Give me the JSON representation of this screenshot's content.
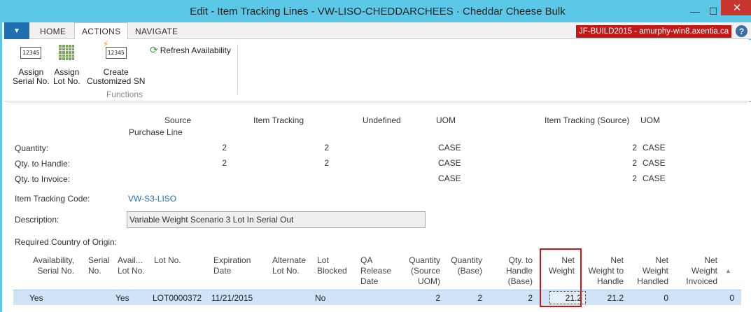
{
  "window": {
    "title": "Edit - Item Tracking Lines - VW-LISO-CHEDDARCHEES · Cheddar Cheese Bulk",
    "minimize_glyph": "—",
    "maximize_glyph": "☐",
    "close_glyph": "✕"
  },
  "ribbon": {
    "tabs": [
      "HOME",
      "ACTIONS",
      "NAVIGATE"
    ],
    "active_tab": "ACTIONS",
    "server_badge": "JF-BUILD2015 - amurphy-win8.axentia.ca",
    "help_glyph": "?",
    "buttons": {
      "assign_serial": {
        "line1": "Assign",
        "line2": "Serial No.",
        "icon": "serial-number-icon"
      },
      "assign_lot": {
        "line1": "Assign",
        "line2": "Lot No.",
        "icon": "lot-grid-icon"
      },
      "create_custom_sn": {
        "line1": "Create",
        "line2": "Customized SN",
        "icon": "custom-serial-icon"
      }
    },
    "refresh_label": "Refresh Availability",
    "group_label": "Functions",
    "serial_icon_text": "12345"
  },
  "summary": {
    "headers": {
      "source": "Source",
      "source_sub": "Purchase Line",
      "item_tracking": "Item Tracking",
      "undefined": "Undefined",
      "uom": "UOM",
      "item_tracking_source": "Item Tracking (Source)",
      "uom2": "UOM"
    },
    "rows": [
      {
        "label": "Quantity:",
        "source": "2",
        "item_tracking": "2",
        "uom": "CASE",
        "its": "2",
        "uom2": "CASE"
      },
      {
        "label": "Qty. to Handle:",
        "source": "2",
        "item_tracking": "2",
        "uom": "CASE",
        "its": "2",
        "uom2": "CASE"
      },
      {
        "label": "Qty. to Invoice:",
        "source": "",
        "item_tracking": "",
        "uom": "CASE",
        "its": "2",
        "uom2": "CASE"
      }
    ]
  },
  "fields": {
    "item_tracking_code_label": "Item Tracking Code:",
    "item_tracking_code_value": "VW-S3-LISO",
    "description_label": "Description:",
    "description_value": "Variable Weight Scenario 3 Lot In Serial Out",
    "required_country_label": "Required Country of Origin:"
  },
  "grid": {
    "columns": [
      {
        "l1": "Availability,",
        "l2": "Serial No.",
        "l3": ""
      },
      {
        "l1": "Serial",
        "l2": "No.",
        "l3": ""
      },
      {
        "l1": "Avail...",
        "l2": "Lot No.",
        "l3": ""
      },
      {
        "l1": "Lot No.",
        "l2": "",
        "l3": ""
      },
      {
        "l1": "Expiration",
        "l2": "Date",
        "l3": ""
      },
      {
        "l1": "Alternate",
        "l2": "Lot No.",
        "l3": ""
      },
      {
        "l1": "Lot",
        "l2": "Blocked",
        "l3": ""
      },
      {
        "l1": "QA",
        "l2": "Release",
        "l3": "Date"
      },
      {
        "l1": "Quantity",
        "l2": "(Source",
        "l3": "UOM)"
      },
      {
        "l1": "Quantity",
        "l2": "(Base)",
        "l3": ""
      },
      {
        "l1": "Qty. to",
        "l2": "Handle",
        "l3": "(Base)"
      },
      {
        "l1": "Net",
        "l2": "Weight",
        "l3": ""
      },
      {
        "l1": "Net",
        "l2": "Weight to",
        "l3": "Handle"
      },
      {
        "l1": "Net",
        "l2": "Weight",
        "l3": "Handled"
      },
      {
        "l1": "Net",
        "l2": "Weight",
        "l3": "Invoiced"
      }
    ],
    "rows": [
      {
        "availability_serial": "Yes",
        "serial_no": "",
        "avail_lot": "Yes",
        "lot_no": "LOT0000372",
        "expiration_date": "11/21/2015",
        "alternate_lot": "",
        "lot_blocked": "No",
        "qa_release": "",
        "qty_source": "2",
        "qty_base": "2",
        "qty_handle_base": "2",
        "net_weight": "21.2",
        "net_weight_to_handle": "21.2",
        "net_weight_handled": "0",
        "net_weight_invoiced": "0"
      }
    ],
    "sort_glyph": "▲"
  },
  "colors": {
    "titlebar": "#5cc8e8",
    "selected_row": "#cfe4f6",
    "highlight": "#d11515",
    "server_badge": "#c41717",
    "link": "#1f6fb2"
  }
}
